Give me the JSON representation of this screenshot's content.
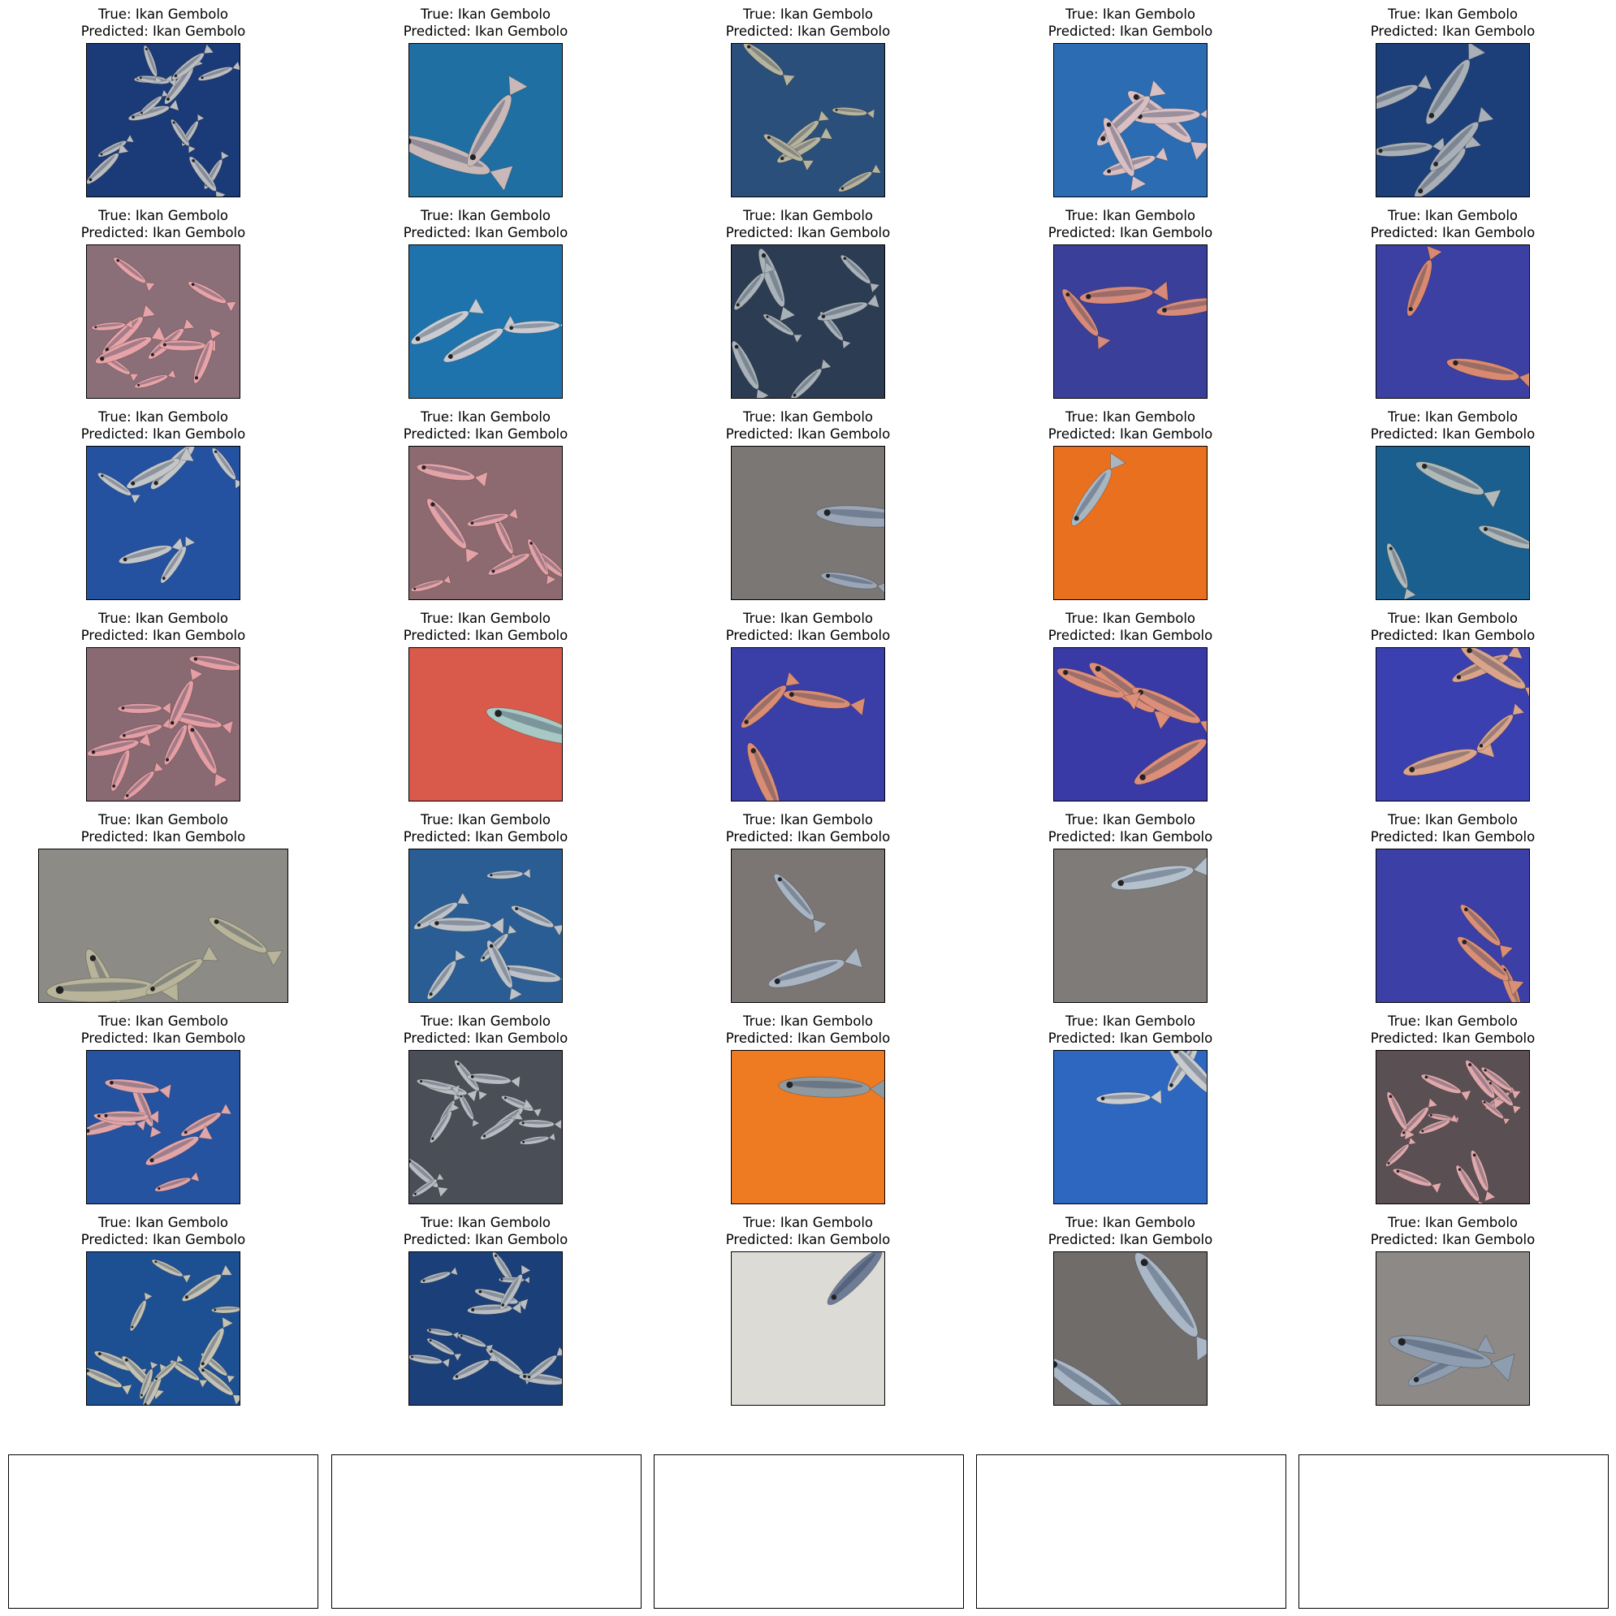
{
  "figure": {
    "title_prefix_true": "True: ",
    "title_prefix_pred": "Predicted: ",
    "rows": [
      [
        {
          "true_label": "Ikan Gembolo",
          "predicted_label": "Ikan Gembolo",
          "photo": {
            "bg": "#1b3a78",
            "fish": "#b9bcc0",
            "count": 14,
            "scene": "pile of silver fish on blue tarp"
          }
        },
        {
          "true_label": "Ikan Gembolo",
          "predicted_label": "Ikan Gembolo",
          "photo": {
            "bg": "#1f6fa3",
            "fish": "#c8b8b8",
            "count": 2,
            "scene": "two fish on blue tarp"
          }
        },
        {
          "true_label": "Ikan Gembolo",
          "predicted_label": "Ikan Gembolo",
          "photo": {
            "bg": "#2a4f7a",
            "fish": "#b7b49e",
            "count": 6,
            "scene": "close-up pile of fish"
          }
        },
        {
          "true_label": "Ikan Gembolo",
          "predicted_label": "Ikan Gembolo",
          "photo": {
            "bg": "#2b6cb3",
            "fish": "#d8bfc4",
            "count": 5,
            "scene": "fish on blue tarp"
          }
        },
        {
          "true_label": "Ikan Gembolo",
          "predicted_label": "Ikan Gembolo",
          "photo": {
            "bg": "#1c3f7a",
            "fish": "#a9afb6",
            "count": 5,
            "scene": "fish on dark blue tarp"
          }
        }
      ],
      [
        {
          "true_label": "Ikan Gembolo",
          "predicted_label": "Ikan Gembolo",
          "photo": {
            "bg": "#8a6f78",
            "fish": "#e7a3a8",
            "count": 10,
            "scene": "pile of pink fish"
          }
        },
        {
          "true_label": "Ikan Gembolo",
          "predicted_label": "Ikan Gembolo",
          "photo": {
            "bg": "#1e73ad",
            "fish": "#c8ccd2",
            "count": 3,
            "scene": "fish on blue tarp"
          }
        },
        {
          "true_label": "Ikan Gembolo",
          "predicted_label": "Ikan Gembolo",
          "photo": {
            "bg": "#2c3c52",
            "fish": "#a9b2b8",
            "count": 8,
            "scene": "pile of grey fish"
          }
        },
        {
          "true_label": "Ikan Gembolo",
          "predicted_label": "Ikan Gembolo",
          "photo": {
            "bg": "#3a3f9a",
            "fish": "#d88a7a",
            "count": 3,
            "scene": "red fish on purple tarp"
          }
        },
        {
          "true_label": "Ikan Gembolo",
          "predicted_label": "Ikan Gembolo",
          "photo": {
            "bg": "#3b40a2",
            "fish": "#d9896f",
            "count": 2,
            "scene": "two red fish on purple tarp"
          }
        }
      ],
      [
        {
          "true_label": "Ikan Gembolo",
          "predicted_label": "Ikan Gembolo",
          "photo": {
            "bg": "#2451a0",
            "fish": "#c3c6c8",
            "count": 6,
            "scene": "fish on blue tarp"
          }
        },
        {
          "true_label": "Ikan Gembolo",
          "predicted_label": "Ikan Gembolo",
          "photo": {
            "bg": "#8c6a70",
            "fish": "#e3a2a6",
            "count": 8,
            "scene": "pile of pink fish"
          }
        },
        {
          "true_label": "Ikan Gembolo",
          "predicted_label": "Ikan Gembolo",
          "photo": {
            "bg": "#7a7775",
            "fish": "#9aa5b5",
            "count": 2,
            "scene": "two fish on concrete"
          }
        },
        {
          "true_label": "Ikan Gembolo",
          "predicted_label": "Ikan Gembolo",
          "photo": {
            "bg": "#e8701e",
            "fish": "#a8b6c2",
            "count": 1,
            "scene": "fish in orange tray"
          }
        },
        {
          "true_label": "Ikan Gembolo",
          "predicted_label": "Ikan Gembolo",
          "photo": {
            "bg": "#1b5f8e",
            "fish": "#b0b8b8",
            "count": 3,
            "scene": "fish on blue tarp"
          }
        }
      ],
      [
        {
          "true_label": "Ikan Gembolo",
          "predicted_label": "Ikan Gembolo",
          "photo": {
            "bg": "#8a6a72",
            "fish": "#e49ea4",
            "count": 10,
            "scene": "pile of pink fish"
          }
        },
        {
          "true_label": "Ikan Gembolo",
          "predicted_label": "Ikan Gembolo",
          "photo": {
            "bg": "#d9594a",
            "fish": "#a8c8c4",
            "count": 1,
            "scene": "hand holding fish on red plastic"
          }
        },
        {
          "true_label": "Ikan Gembolo",
          "predicted_label": "Ikan Gembolo",
          "photo": {
            "bg": "#3a3fa8",
            "fish": "#d98d73",
            "count": 3,
            "scene": "red fish on purple tarp"
          }
        },
        {
          "true_label": "Ikan Gembolo",
          "predicted_label": "Ikan Gembolo",
          "photo": {
            "bg": "#3a3aa6",
            "fish": "#dc8e78",
            "count": 4,
            "scene": "red fish on purple tarp"
          }
        },
        {
          "true_label": "Ikan Gembolo",
          "predicted_label": "Ikan Gembolo",
          "photo": {
            "bg": "#3a40b0",
            "fish": "#d9a48a",
            "count": 4,
            "scene": "fish on purple tarp"
          }
        }
      ],
      [
        {
          "true_label": "Ikan Gembolo",
          "predicted_label": "Ikan Gembolo",
          "photo": {
            "bg": "#8d8b86",
            "fish": "#b8b49a",
            "count": 4,
            "scene": "close-up of fish pile",
            "wide": true
          }
        },
        {
          "true_label": "Ikan Gembolo",
          "predicted_label": "Ikan Gembolo",
          "photo": {
            "bg": "#2a5d94",
            "fish": "#bcc2c8",
            "count": 8,
            "scene": "fish on blue tarp"
          }
        },
        {
          "true_label": "Ikan Gembolo",
          "predicted_label": "Ikan Gembolo",
          "photo": {
            "bg": "#7b7673",
            "fish": "#a9b5c2",
            "count": 2,
            "scene": "two fish on concrete"
          }
        },
        {
          "true_label": "Ikan Gembolo",
          "predicted_label": "Ikan Gembolo",
          "photo": {
            "bg": "#7e7b78",
            "fish": "#b4c0cc",
            "count": 1,
            "scene": "single fish on concrete"
          }
        },
        {
          "true_label": "Ikan Gembolo",
          "predicted_label": "Ikan Gembolo",
          "photo": {
            "bg": "#3b3fa6",
            "fish": "#d98f76",
            "count": 3,
            "scene": "fish on purple tarp"
          }
        }
      ],
      [
        {
          "true_label": "Ikan Gembolo",
          "predicted_label": "Ikan Gembolo",
          "photo": {
            "bg": "#2553a0",
            "fish": "#dfa5a9",
            "count": 8,
            "scene": "pink fish on blue tarp"
          }
        },
        {
          "true_label": "Ikan Gembolo",
          "predicted_label": "Ikan Gembolo",
          "photo": {
            "bg": "#4a4e56",
            "fish": "#b9bcc2",
            "count": 14,
            "scene": "pile of silver fish"
          }
        },
        {
          "true_label": "Ikan Gembolo",
          "predicted_label": "Ikan Gembolo",
          "photo": {
            "bg": "#ee7a22",
            "fish": "#8f9aa0",
            "count": 1,
            "scene": "fish in orange tray"
          }
        },
        {
          "true_label": "Ikan Gembolo",
          "predicted_label": "Ikan Gembolo",
          "photo": {
            "bg": "#2d67c0",
            "fish": "#c9cccf",
            "count": 3,
            "scene": "fish on blue tarp"
          }
        },
        {
          "true_label": "Ikan Gembolo",
          "predicted_label": "Ikan Gembolo",
          "photo": {
            "bg": "#5a4f52",
            "fish": "#e0a8ab",
            "count": 14,
            "scene": "pile of pink fish"
          }
        }
      ],
      [
        {
          "true_label": "Ikan Gembolo",
          "predicted_label": "Ikan Gembolo",
          "photo": {
            "bg": "#1d4f93",
            "fish": "#c4c2b4",
            "count": 14,
            "scene": "pile of silver fish"
          }
        },
        {
          "true_label": "Ikan Gembolo",
          "predicted_label": "Ikan Gembolo",
          "photo": {
            "bg": "#1b3f78",
            "fish": "#b8bdc2",
            "count": 14,
            "scene": "pile of silver fish"
          }
        },
        {
          "true_label": "Ikan Gembolo",
          "predicted_label": "Ikan Gembolo",
          "photo": {
            "bg": "#dddbd6",
            "fish": "#6f7c96",
            "count": 1,
            "scene": "fish on white board"
          }
        },
        {
          "true_label": "Ikan Gembolo",
          "predicted_label": "Ikan Gembolo",
          "photo": {
            "bg": "#6f6c6a",
            "fish": "#a9b7c6",
            "count": 2,
            "scene": "two fish on stone"
          }
        },
        {
          "true_label": "Ikan Gembolo",
          "predicted_label": "Ikan Gembolo",
          "photo": {
            "bg": "#8c8986",
            "fish": "#8f9db0",
            "count": 2,
            "scene": "two fish on concrete"
          }
        }
      ]
    ],
    "empty_axes_count": 5
  }
}
